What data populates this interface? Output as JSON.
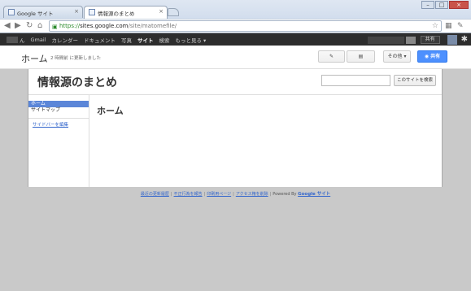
{
  "browser": {
    "tabs": [
      {
        "label": "Google サイト",
        "active": false
      },
      {
        "label": "情報源のまとめ",
        "active": true
      }
    ],
    "url": {
      "scheme": "https://",
      "host": "sites.google.com",
      "path": "/site/matomefile/"
    }
  },
  "gbar": {
    "items": [
      "ん",
      "Gmail",
      "カレンダー",
      "ドキュメント",
      "写真",
      "サイト",
      "検索",
      "もっと見る ▾"
    ],
    "active_index": 5,
    "share_label": "共有"
  },
  "sites": {
    "page_title": "ホーム",
    "updated": "2 時間前 に更新しました",
    "more_label": "その他 ▾",
    "share_label": "共有"
  },
  "site": {
    "name": "情報源のまとめ",
    "search_button": "このサイトを検索",
    "search_value": "",
    "sidebar": {
      "items": [
        "ホーム",
        "サイトマップ"
      ],
      "active_index": 0,
      "edit_link": "サイドバーを編集"
    },
    "content_title": "ホーム"
  },
  "footer": {
    "links": [
      "最近の更新履歴",
      "不正行為を報告",
      "印刷用ページ",
      "アクセス権を削除"
    ],
    "powered_by": "Powered By",
    "brand": "Google サイト"
  },
  "colors": {
    "accent": "#4d90fe",
    "sidebar_active": "#5b86d8",
    "gbar_bg": "#2d2d2d"
  }
}
